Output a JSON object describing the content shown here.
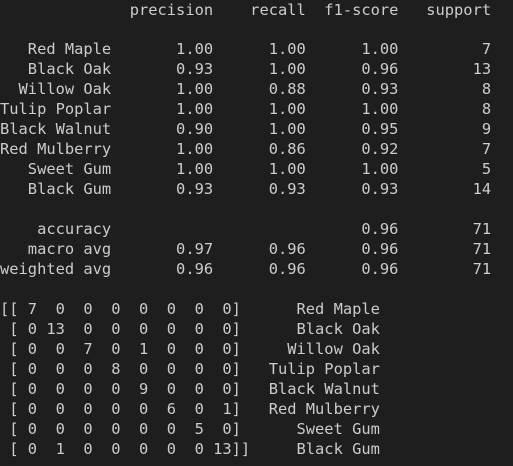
{
  "report": {
    "header": "              precision    recall  f1-score   support",
    "rows": [
      "   Red Maple       1.00      1.00      1.00         7",
      "   Black Oak       0.93      1.00      0.96        13",
      "  Willow Oak       1.00      0.88      0.93         8",
      "Tulip Poplar       1.00      1.00      1.00         8",
      "Black Walnut       0.90      1.00      0.95         9",
      "Red Mulberry       1.00      0.86      0.92         7",
      "   Sweet Gum       1.00      1.00      1.00         5",
      "   Black Gum       0.93      0.93      0.93        14"
    ],
    "summary": [
      "    accuracy                           0.96        71",
      "   macro avg       0.97      0.96      0.96        71",
      "weighted avg       0.96      0.96      0.96        71"
    ]
  },
  "confusion_matrix": [
    "[[ 7  0  0  0  0  0  0  0]      Red Maple",
    " [ 0 13  0  0  0  0  0  0]      Black Oak",
    " [ 0  0  7  0  1  0  0  0]     Willow Oak",
    " [ 0  0  0  8  0  0  0  0]   Tulip Poplar",
    " [ 0  0  0  0  9  0  0  0]   Black Walnut",
    " [ 0  0  0  0  0  6  0  1]   Red Mulberry",
    " [ 0  0  0  0  0  0  5  0]      Sweet Gum",
    " [ 0  1  0  0  0  0  0 13]]     Black Gum"
  ]
}
